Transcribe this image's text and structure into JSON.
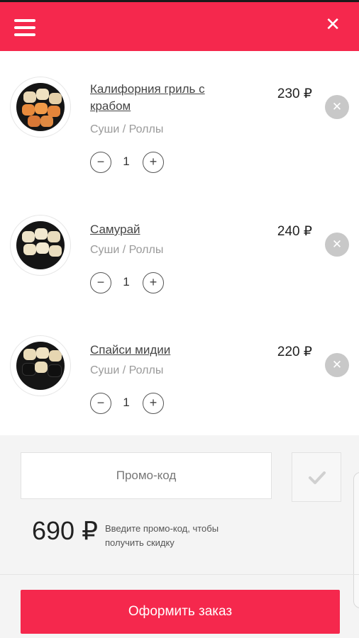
{
  "header": {
    "menu_icon": "hamburger-menu-icon",
    "close_label": "✕"
  },
  "colors": {
    "accent": "#f5284d",
    "remove_bg": "#c8c8c8"
  },
  "cart": {
    "items": [
      {
        "name": "Калифорния гриль с крабом",
        "category": "Суши / Роллы",
        "price": "230 ₽",
        "quantity": "1",
        "remove_label": "✕",
        "minus_label": "−",
        "plus_label": "+"
      },
      {
        "name": "Самурай",
        "category": "Суши / Роллы",
        "price": "240 ₽",
        "quantity": "1",
        "remove_label": "✕",
        "minus_label": "−",
        "plus_label": "+"
      },
      {
        "name": "Спайси мидии",
        "category": "Суши / Роллы",
        "price": "220 ₽",
        "quantity": "1",
        "remove_label": "✕",
        "minus_label": "−",
        "plus_label": "+"
      }
    ]
  },
  "promo": {
    "placeholder": "Промо-код",
    "apply_icon": "checkmark-icon",
    "hint": "Введите промо-код, чтобы получить скидку"
  },
  "summary": {
    "total": "690 ₽"
  },
  "checkout": {
    "button_label": "Оформить заказ"
  }
}
